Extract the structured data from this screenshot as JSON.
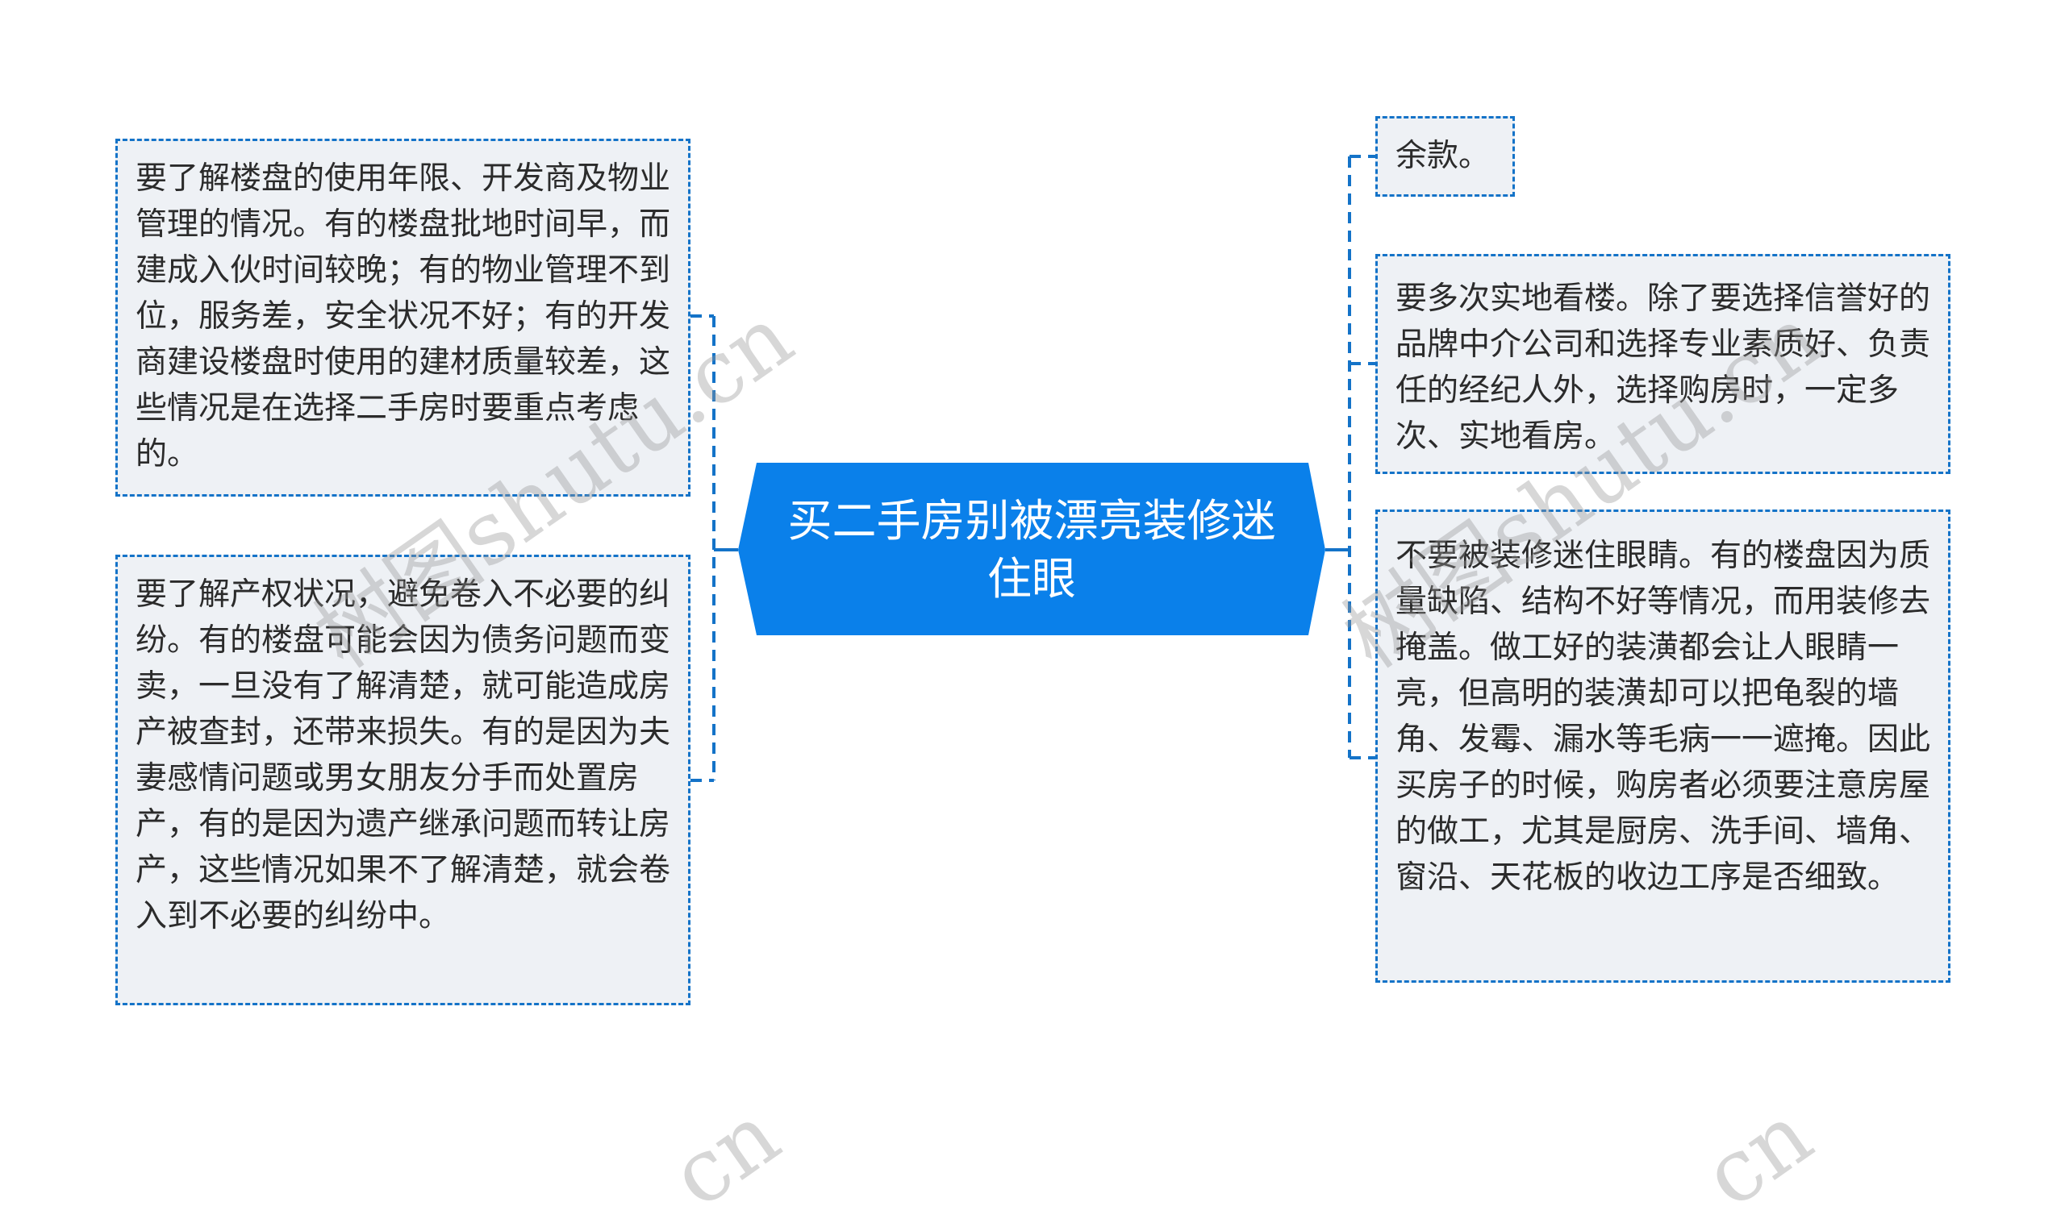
{
  "diagram": {
    "type": "mind-map",
    "root": {
      "title": "买二手房别被漂亮装修迷住眼",
      "color": "#0a80ea"
    },
    "left_branches": [
      {
        "text": "要了解楼盘的使用年限、开发商及物业管理的情况。有的楼盘批地时间早，而建成入伙时间较晚；有的物业管理不到位，服务差，安全状况不好；有的开发商建设楼盘时使用的建材质量较差，这些情况是在选择二手房时要重点考虑的。"
      },
      {
        "text": "要了解产权状况，避免卷入不必要的纠纷。有的楼盘可能会因为债务问题而变卖，一旦没有了解清楚，就可能造成房产被查封，还带来损失。有的是因为夫妻感情问题或男女朋友分手而处置房产，有的是因为遗产继承问题而转让房产，这些情况如果不了解清楚，就会卷入到不必要的纠纷中。"
      }
    ],
    "right_branches": [
      {
        "text": "余款。"
      },
      {
        "text": "要多次实地看楼。除了要选择信誉好的品牌中介公司和选择专业素质好、负责任的经纪人外，选择购房时，一定多次、实地看房。"
      },
      {
        "text": "不要被装修迷住眼睛。有的楼盘因为质量缺陷、结构不好等情况，而用装修去掩盖。做工好的装潢都会让人眼睛一亮，但高明的装潢却可以把龟裂的墙角、发霉、漏水等毛病一一遮掩。因此买房子的时候，购房者必须要注意房屋的做工，尤其是厨房、洗手间、墙角、窗沿、天花板的收边工序是否细致。"
      }
    ],
    "colors": {
      "connector": "#1473c8",
      "node_fill": "#eef1f5",
      "text": "#2b2b2b"
    }
  },
  "watermark": {
    "text": "树图shutu.cn",
    "fragment": "cn"
  }
}
